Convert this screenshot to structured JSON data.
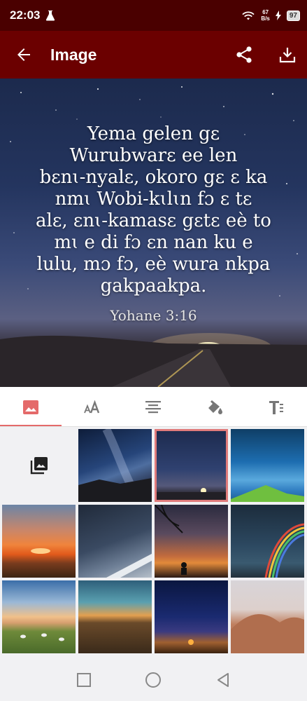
{
  "status_bar": {
    "time": "22:03",
    "net_speed_value": "67",
    "net_speed_unit": "B/s",
    "battery": "97",
    "icons": [
      "flask-icon",
      "wifi-icon",
      "charging-icon",
      "battery-icon"
    ]
  },
  "app_bar": {
    "title": "Image",
    "back_icon": "back-arrow-icon",
    "actions": [
      "share-icon",
      "download-icon"
    ],
    "background": "#6b0000"
  },
  "preview": {
    "verse_lines": [
      "Yema gelen gɛ",
      "Wurubwarɛ ee len",
      "bɛnɩ-nyalɛ, okoro gɛ ɛ ka",
      "nmɩ Wobi-kɩlɩn fɔ ɛ tɛ",
      "alɛ, ɛnɩ-kamasɛ gɛtɛ eè to",
      "mɩ e di fɔ ɛn nan ku e",
      "lulu, mɔ fɔ, eè wura nkpa",
      "gakpaakpa."
    ],
    "reference": "Yohane 3:16"
  },
  "tabs": [
    {
      "icon": "image-icon",
      "active": true
    },
    {
      "icon": "font-size-icon",
      "active": false
    },
    {
      "icon": "align-center-icon",
      "active": false
    },
    {
      "icon": "paint-bucket-icon",
      "active": false
    },
    {
      "icon": "text-format-icon",
      "active": false
    }
  ],
  "accent_color": "#e46a6a",
  "gallery": {
    "picker_icon": "photo-library-icon",
    "thumbnails": [
      {
        "name": "milky-way",
        "selected": false
      },
      {
        "name": "starry-road",
        "selected": true
      },
      {
        "name": "blue-storm-island",
        "selected": false
      },
      {
        "name": "orange-sunset-sea",
        "selected": false
      },
      {
        "name": "star-trails-wing",
        "selected": false
      },
      {
        "name": "sunset-tree-silhouette",
        "selected": false
      },
      {
        "name": "rainbow-ocean",
        "selected": false
      },
      {
        "name": "sheep-meadow-sky",
        "selected": false
      },
      {
        "name": "dusk-field",
        "selected": false
      },
      {
        "name": "desert-night-camp",
        "selected": false
      },
      {
        "name": "sand-dunes",
        "selected": false
      }
    ]
  },
  "nav_bar": [
    "recents-square-icon",
    "home-circle-icon",
    "back-triangle-icon"
  ]
}
